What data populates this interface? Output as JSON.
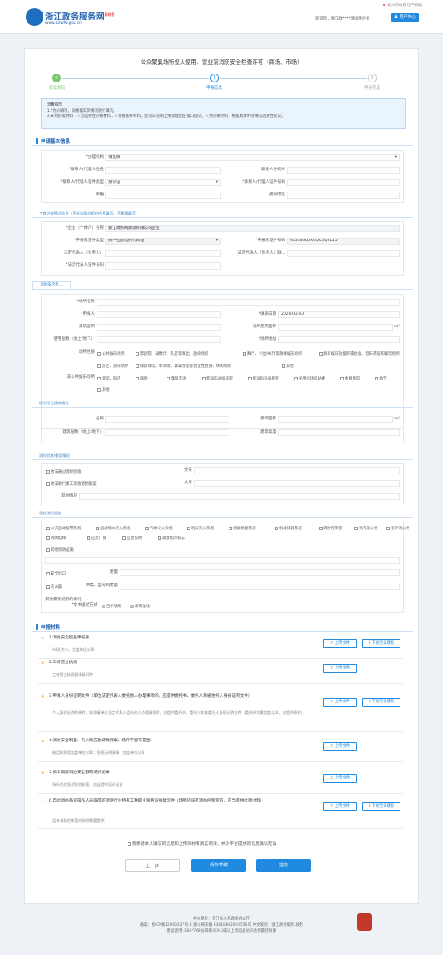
{
  "header": {
    "brand": "浙江政务服务网",
    "brand_badge": "浙政钉",
    "url": "www.zjzwfw.gov.cn",
    "location": "杭州市政府门户网站",
    "welcome": "欢迎您，浙江政****测试用企业",
    "user_center": "用户中心"
  },
  "title": "公众聚集场所投入使用、营业前消防安全检查许可（商场、市场）",
  "steps": [
    {
      "label": "阅读须知",
      "num": "✓"
    },
    {
      "label": "申报信息",
      "num": "2"
    },
    {
      "label": "申报完成",
      "num": "3"
    }
  ],
  "tips": {
    "head": "温馨提示",
    "line1": "1.*为必填项，请根据实际情况进行填写。",
    "line2": "2.★为必需材料，☆为选择性必要材料，☆为根据补材料，您可以在网上预受理后在窗口提交，☆为必要材料，根据具体申请情况选择性提交。"
  },
  "basic": {
    "section": "申请基本信息",
    "org_label": "*办理机构",
    "org_value": "请选择",
    "name_label": "*联系人/代理人姓名",
    "phone_label": "*联系人手机号",
    "idtype_label": "*联系人/代理人证件类型",
    "idtype_value": "身份证",
    "idno_label": "*联系人/代理人证件号码",
    "email_label": "邮编",
    "addr_label": "通讯地址"
  },
  "company": {
    "sub": "工商注册登记信息（营业执照的相应信息填写，不需要填写）",
    "name_label": "*企业（个体户）名称",
    "name_value": "浙江政务网测试有限公司企业",
    "ctype_label": "*申报者证件类型",
    "ctype_value": "统一社会信用代码证",
    "cno_label": "*申报者证件号码",
    "cno_value": "91330000XUQCSQY125",
    "legal_label": "法定代表人（负责人）",
    "legal_label2": "法定代表人（负责人）联...",
    "legal_id_label": "*法定代表人证件号码"
  },
  "fire": {
    "tab": "消防安全检...",
    "name_label": "*场所名称",
    "applicant_label": "*申报人",
    "date_label": "*填表日期",
    "date_value": "2020-02-03",
    "area_label": "建筑面积",
    "use_area_label": "场所使用面积",
    "unit": "m²",
    "floor_label": "使用层数（地上/地下）",
    "addr_label": "*场所地址",
    "type_label": "场所性质",
    "types_row1": [
      "公共娱乐场所",
      "影剧院、录像厅、礼堂等演出、放映场所",
      "舞厅、卡拉OK厅等歌舞娱乐场所",
      "具有娱乐功能的夜总会、音乐茶座和餐饮场所"
    ],
    "types_row2": [
      "游艺、游乐场所",
      "保龄球馆、旱冰场、桑拿浴室等营业性健身、休闲场所",
      "其他"
    ],
    "other_label": "非公共娱乐场所",
    "types_row3": [
      "宾馆、饭店",
      "商场",
      "集贸市场",
      "客运车站候车室",
      "客运码头候船室",
      "民用机场航站楼",
      "体育场馆",
      "会堂"
    ],
    "types_row4": [
      "其他"
    ]
  },
  "building": {
    "sub": "场所所在建筑情况",
    "name_label": "名称",
    "area_label": "建筑面积",
    "floors_label": "建筑层数（地上/地下）",
    "height_label": "建筑高度"
  },
  "acceptance": {
    "sub": "消防验收/备案情况",
    "opt1": "依法通过消防验收",
    "opt2": "依法进行竣工验收消防备案",
    "doc_label": "文号",
    "other_label": "其他情况"
  },
  "facilities": {
    "sub": "现有消防设施",
    "items": [
      "火灾自动报警系统",
      "自动喷水灭火系统",
      "气体灭火系统",
      "泡沫灭火系统",
      "机械防烟系统",
      "机械排烟系统",
      "消防控制室",
      "室内消火栓",
      "室外消火栓",
      "消防电梯",
      "应急广播",
      "应急照明",
      "疏散指示标志"
    ],
    "other": "其他消防设施",
    "exit": "安全出口",
    "extinguisher": "灭火器",
    "qty_label": "数量",
    "spec_label": "种类、型号和数量",
    "other_info": "其他需要说明的情况"
  },
  "delivery": {
    "label": "*文书送达方式",
    "opt1": "自行领取",
    "opt2": "邮寄送达"
  },
  "materials": {
    "section": "申报材料",
    "upload": "上传文件",
    "template": "下载空白模板",
    "items": [
      {
        "name": "1.消防安全检查申报表",
        "note": "A4纸大小，加盖单位公章"
      },
      {
        "name": "2.工商营业执照",
        "note": "工商营业执照副本复印件"
      },
      {
        "name": "3.申请人身份证明文件（单位法定代表人委托他人办理事项的，应提供委托书、委托人和被委托人身份证明文件）",
        "note": "个人身份证件的原件，如申请单位法定代表人委托他人办理事项的，应提供委托书、委托人和被委托人身份证明文件（委托书均需加盖公章，应提供原件）"
      },
      {
        "name": "4.消防安全制度、灭火和应急疏散预案、场所平面布置图",
        "note": "制度和预案加盖单位公章；图纸标明清晰，加盖单位公章"
      },
      {
        "name": "5.员工岗前消防安全教育培训记录",
        "note": "场所内应急消防控制室，应当提供培训记录"
      },
      {
        "name": "6.自动消防系统操作人员取得的消防行业特有工种职业资格证书复印件（场所内设有消防控制室的，应当提供此项材料）",
        "note": "设有消防控制室的场所需要提供"
      }
    ]
  },
  "agree": "我承诺本人填写的信息和上传的材料真实有效，并对平台提供的信息确认无误",
  "buttons": {
    "prev": "上一步",
    "save": "保存草稿",
    "submit": "提交"
  },
  "footer": {
    "line1": "主办单位：浙江省人民政府办公厅",
    "line2": "备案：浙ICP备12000337号-2    浙公网安备 33010602004556号    中文域名：浙江政务服务.政务",
    "line3": "建议使用1366*768分辨率/IE9.0或以上浏览器访问达到最佳效果"
  },
  "colors": {
    "primary": "#1f8ae0",
    "star": "#f08a00"
  }
}
